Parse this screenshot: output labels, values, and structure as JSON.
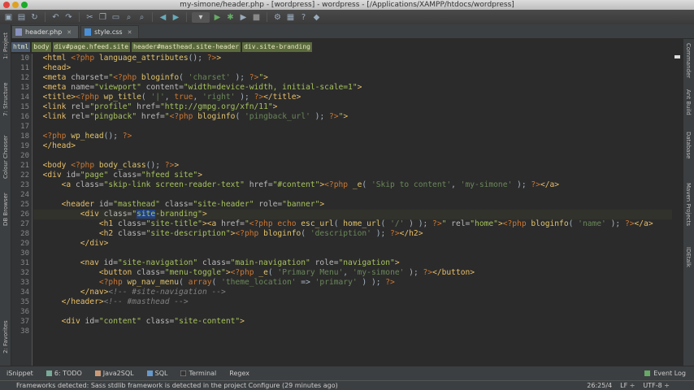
{
  "window": {
    "title": "my-simone/header.php - [wordpress] - wordpress - [/Applications/XAMPP/htdocs/wordpress]"
  },
  "toolbar": {
    "icons": [
      "folder-open-icon",
      "save-icon",
      "sync-icon",
      "undo-icon",
      "redo-icon",
      "cut-icon",
      "copy-icon",
      "paste-icon",
      "find-icon",
      "replace-icon",
      "back-icon",
      "forward-icon",
      "run-config-dropdown",
      "run-icon",
      "debug-icon",
      "coverage-icon",
      "stop-icon",
      "settings-icon",
      "project-structure-icon",
      "help-icon"
    ]
  },
  "tabs": [
    {
      "label": "header.php",
      "active": true
    },
    {
      "label": "style.css",
      "active": false
    }
  ],
  "breadcrumbs": [
    "html",
    "body",
    "div#page.hfeed.site",
    "header#masthead.site-header",
    "div.site-branding"
  ],
  "left_tools": {
    "project": "1: Project",
    "structure": "7: Structure",
    "colour": "Colour Chooser",
    "db": "DB Browser",
    "favorites": "2: Favorites"
  },
  "right_tools": {
    "commander": "Commander",
    "ant": "Ant Build",
    "database": "Database",
    "maven": "Maven Projects",
    "idetalk": "IDEtalk"
  },
  "code": {
    "line_numbers": [
      "10",
      "11",
      "12",
      "13",
      "14",
      "15",
      "16",
      "17",
      "18",
      "19",
      "20",
      "21",
      "22",
      "23",
      "24",
      "25",
      "26",
      "27",
      "28",
      "29",
      "30",
      "31",
      "32",
      "33",
      "34",
      "35",
      "36",
      "37",
      "38"
    ],
    "current_line_index": 16
  },
  "bottom_tools": {
    "isnippet": "iSnippet",
    "todo": "6: TODO",
    "java2sql": "Java2SQL",
    "sql": "SQL",
    "terminal": "Terminal",
    "regex": "Regex",
    "event_log": "Event Log"
  },
  "status": {
    "message": "Frameworks detected: Sass stdlib framework is detected in the project Configure (29 minutes ago)",
    "position": "26:25/4",
    "line_sep": "LF ÷",
    "encoding": "UTF-8 ÷"
  },
  "colors": {
    "tag": "#e8bf6a",
    "string": "#a5c25c",
    "php_keyword": "#cc7832",
    "comment": "#808080",
    "background": "#2b2b2b"
  }
}
